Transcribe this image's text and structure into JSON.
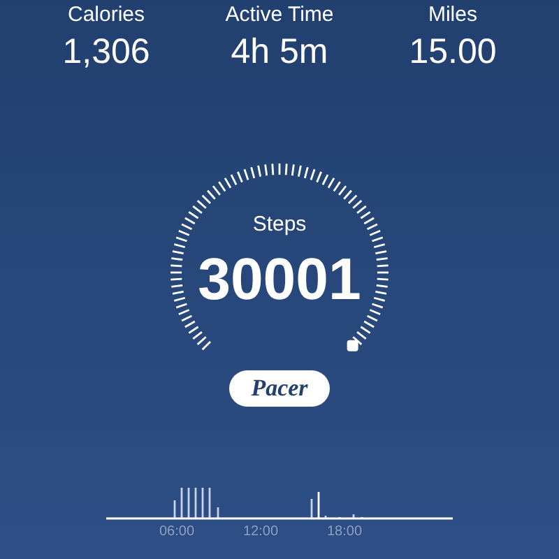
{
  "stats": [
    {
      "label": "Calories",
      "value": "1,306"
    },
    {
      "label": "Active Time",
      "value": "4h 5m"
    },
    {
      "label": "Miles",
      "value": "15.00"
    }
  ],
  "gauge": {
    "label": "Steps",
    "value": "30001"
  },
  "logo": "Pacer",
  "timeline": {
    "ticks": [
      "06:00",
      "12:00",
      "18:00"
    ]
  }
}
